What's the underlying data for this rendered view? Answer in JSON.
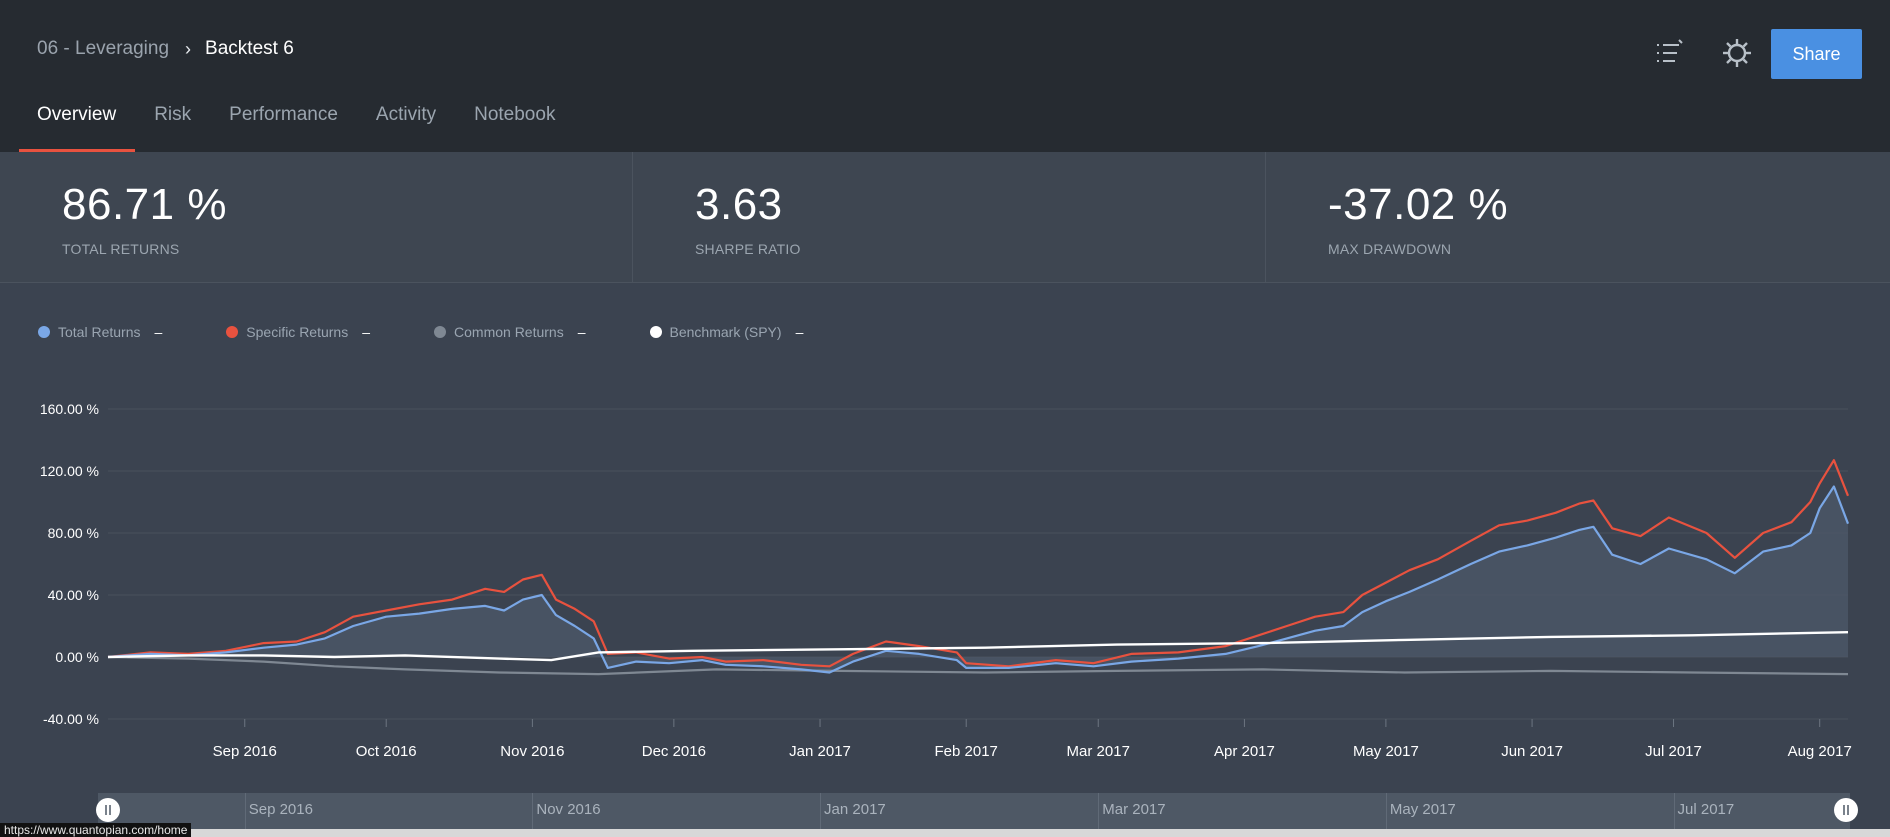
{
  "breadcrumb": {
    "parent": "06 - Leveraging",
    "separator": "›",
    "current": "Backtest 6"
  },
  "tabs": [
    {
      "label": "Overview",
      "active": true
    },
    {
      "label": "Risk",
      "active": false
    },
    {
      "label": "Performance",
      "active": false
    },
    {
      "label": "Activity",
      "active": false
    },
    {
      "label": "Notebook",
      "active": false
    }
  ],
  "header_actions": {
    "list_icon": "list-icon",
    "settings_icon": "gear-icon",
    "share_label": "Share"
  },
  "stats": {
    "total_returns": {
      "value": "86.71 %",
      "label": "TOTAL RETURNS"
    },
    "sharpe_ratio": {
      "value": "3.63",
      "label": "SHARPE RATIO"
    },
    "max_drawdown": {
      "value": "-37.02 %",
      "label": "MAX DRAWDOWN"
    }
  },
  "legend": [
    {
      "name": "Total Returns",
      "value": "–",
      "color": "#7aa7e6"
    },
    {
      "name": "Specific Returns",
      "value": "–",
      "color": "#e8523f"
    },
    {
      "name": "Common Returns",
      "value": "–",
      "color": "#7f8893"
    },
    {
      "name": "Benchmark (SPY)",
      "value": "–",
      "color": "#ffffff"
    }
  ],
  "chart_data": {
    "type": "line",
    "y_tick_labels": [
      "160.00 %",
      "120.00 %",
      "80.00 %",
      "40.00 %",
      "0.00 %",
      "-40.00 %"
    ],
    "y_ticks": [
      160,
      120,
      80,
      40,
      0,
      -40
    ],
    "ylim": [
      -40,
      160
    ],
    "x_tick_labels": [
      "Sep 2016",
      "Oct 2016",
      "Nov 2016",
      "Dec 2016",
      "Jan 2017",
      "Feb 2017",
      "Mar 2017",
      "Apr 2017",
      "May 2017",
      "Jun 2017",
      "Jul 2017",
      "Aug 2017"
    ],
    "x_ticks": [
      "2016-09-01",
      "2016-10-01",
      "2016-11-01",
      "2016-12-01",
      "2017-01-01",
      "2017-02-01",
      "2017-03-01",
      "2017-04-01",
      "2017-05-01",
      "2017-06-01",
      "2017-07-01",
      "2017-08-01"
    ],
    "xlim": [
      "2016-08-03",
      "2017-08-07"
    ],
    "grid": true,
    "series": [
      {
        "name": "Specific Returns",
        "color": "#e8523f",
        "points": [
          [
            "2016-08-03",
            0
          ],
          [
            "2016-08-12",
            3
          ],
          [
            "2016-08-20",
            2
          ],
          [
            "2016-08-28",
            4
          ],
          [
            "2016-09-05",
            9
          ],
          [
            "2016-09-12",
            10
          ],
          [
            "2016-09-18",
            16
          ],
          [
            "2016-09-24",
            26
          ],
          [
            "2016-10-01",
            30
          ],
          [
            "2016-10-08",
            34
          ],
          [
            "2016-10-15",
            37
          ],
          [
            "2016-10-22",
            44
          ],
          [
            "2016-10-26",
            42
          ],
          [
            "2016-10-30",
            50
          ],
          [
            "2016-11-03",
            53
          ],
          [
            "2016-11-06",
            37
          ],
          [
            "2016-11-10",
            31
          ],
          [
            "2016-11-14",
            23
          ],
          [
            "2016-11-17",
            2
          ],
          [
            "2016-11-23",
            3
          ],
          [
            "2016-11-30",
            -1
          ],
          [
            "2016-12-07",
            0
          ],
          [
            "2016-12-12",
            -3
          ],
          [
            "2016-12-20",
            -2
          ],
          [
            "2016-12-28",
            -5
          ],
          [
            "2017-01-03",
            -6
          ],
          [
            "2017-01-08",
            2
          ],
          [
            "2017-01-15",
            10
          ],
          [
            "2017-01-22",
            7
          ],
          [
            "2017-01-30",
            3
          ],
          [
            "2017-02-01",
            -4
          ],
          [
            "2017-02-10",
            -6
          ],
          [
            "2017-02-20",
            -2
          ],
          [
            "2017-02-28",
            -4
          ],
          [
            "2017-03-08",
            2
          ],
          [
            "2017-03-18",
            3
          ],
          [
            "2017-03-28",
            7
          ],
          [
            "2017-04-04",
            14
          ],
          [
            "2017-04-10",
            20
          ],
          [
            "2017-04-16",
            26
          ],
          [
            "2017-04-22",
            29
          ],
          [
            "2017-04-26",
            40
          ],
          [
            "2017-05-01",
            48
          ],
          [
            "2017-05-06",
            56
          ],
          [
            "2017-05-12",
            63
          ],
          [
            "2017-05-19",
            75
          ],
          [
            "2017-05-25",
            85
          ],
          [
            "2017-05-31",
            88
          ],
          [
            "2017-06-06",
            93
          ],
          [
            "2017-06-11",
            99
          ],
          [
            "2017-06-14",
            101
          ],
          [
            "2017-06-18",
            83
          ],
          [
            "2017-06-24",
            78
          ],
          [
            "2017-06-30",
            90
          ],
          [
            "2017-07-08",
            80
          ],
          [
            "2017-07-14",
            64
          ],
          [
            "2017-07-20",
            80
          ],
          [
            "2017-07-26",
            87
          ],
          [
            "2017-07-30",
            100
          ],
          [
            "2017-08-01",
            112
          ],
          [
            "2017-08-04",
            127
          ],
          [
            "2017-08-07",
            104
          ]
        ]
      },
      {
        "name": "Total Returns",
        "color": "#7aa7e6",
        "points": [
          [
            "2016-08-03",
            0
          ],
          [
            "2016-08-12",
            2
          ],
          [
            "2016-08-20",
            1
          ],
          [
            "2016-08-28",
            3
          ],
          [
            "2016-09-05",
            6
          ],
          [
            "2016-09-12",
            8
          ],
          [
            "2016-09-18",
            12
          ],
          [
            "2016-09-24",
            20
          ],
          [
            "2016-10-01",
            26
          ],
          [
            "2016-10-08",
            28
          ],
          [
            "2016-10-15",
            31
          ],
          [
            "2016-10-22",
            33
          ],
          [
            "2016-10-26",
            30
          ],
          [
            "2016-10-30",
            37
          ],
          [
            "2016-11-03",
            40
          ],
          [
            "2016-11-06",
            27
          ],
          [
            "2016-11-10",
            20
          ],
          [
            "2016-11-14",
            12
          ],
          [
            "2016-11-17",
            -7
          ],
          [
            "2016-11-23",
            -3
          ],
          [
            "2016-11-30",
            -4
          ],
          [
            "2016-12-07",
            -2
          ],
          [
            "2016-12-12",
            -5
          ],
          [
            "2016-12-20",
            -6
          ],
          [
            "2016-12-28",
            -8
          ],
          [
            "2017-01-03",
            -10
          ],
          [
            "2017-01-08",
            -3
          ],
          [
            "2017-01-15",
            4
          ],
          [
            "2017-01-22",
            2
          ],
          [
            "2017-01-30",
            -2
          ],
          [
            "2017-02-01",
            -7
          ],
          [
            "2017-02-10",
            -7
          ],
          [
            "2017-02-20",
            -4
          ],
          [
            "2017-02-28",
            -6
          ],
          [
            "2017-03-08",
            -3
          ],
          [
            "2017-03-18",
            -1
          ],
          [
            "2017-03-28",
            2
          ],
          [
            "2017-04-04",
            7
          ],
          [
            "2017-04-10",
            12
          ],
          [
            "2017-04-16",
            17
          ],
          [
            "2017-04-22",
            20
          ],
          [
            "2017-04-26",
            29
          ],
          [
            "2017-05-01",
            36
          ],
          [
            "2017-05-06",
            42
          ],
          [
            "2017-05-12",
            50
          ],
          [
            "2017-05-19",
            60
          ],
          [
            "2017-05-25",
            68
          ],
          [
            "2017-05-31",
            72
          ],
          [
            "2017-06-06",
            77
          ],
          [
            "2017-06-11",
            82
          ],
          [
            "2017-06-14",
            84
          ],
          [
            "2017-06-18",
            66
          ],
          [
            "2017-06-24",
            60
          ],
          [
            "2017-06-30",
            70
          ],
          [
            "2017-07-08",
            63
          ],
          [
            "2017-07-14",
            54
          ],
          [
            "2017-07-20",
            68
          ],
          [
            "2017-07-26",
            72
          ],
          [
            "2017-07-30",
            80
          ],
          [
            "2017-08-01",
            96
          ],
          [
            "2017-08-04",
            110
          ],
          [
            "2017-08-07",
            86
          ]
        ]
      },
      {
        "name": "Common Returns",
        "color": "#7f8893",
        "points": [
          [
            "2016-08-03",
            0
          ],
          [
            "2016-08-20",
            -1
          ],
          [
            "2016-09-05",
            -3
          ],
          [
            "2016-09-20",
            -6
          ],
          [
            "2016-10-05",
            -8
          ],
          [
            "2016-10-25",
            -10
          ],
          [
            "2016-11-15",
            -11
          ],
          [
            "2016-12-10",
            -8
          ],
          [
            "2017-01-05",
            -9
          ],
          [
            "2017-02-05",
            -10
          ],
          [
            "2017-03-05",
            -9
          ],
          [
            "2017-04-05",
            -8
          ],
          [
            "2017-05-05",
            -10
          ],
          [
            "2017-06-05",
            -9
          ],
          [
            "2017-07-05",
            -10
          ],
          [
            "2017-08-07",
            -11
          ]
        ]
      },
      {
        "name": "Benchmark (SPY)",
        "color": "#ffffff",
        "points": [
          [
            "2016-08-03",
            0
          ],
          [
            "2016-08-20",
            1
          ],
          [
            "2016-09-05",
            1
          ],
          [
            "2016-09-20",
            0
          ],
          [
            "2016-10-05",
            1
          ],
          [
            "2016-10-25",
            -1
          ],
          [
            "2016-11-05",
            -2
          ],
          [
            "2016-11-15",
            3
          ],
          [
            "2016-12-05",
            4
          ],
          [
            "2017-01-05",
            5
          ],
          [
            "2017-02-05",
            6
          ],
          [
            "2017-03-05",
            8
          ],
          [
            "2017-04-05",
            9
          ],
          [
            "2017-05-05",
            11
          ],
          [
            "2017-06-05",
            13
          ],
          [
            "2017-07-05",
            14
          ],
          [
            "2017-08-07",
            16
          ]
        ]
      }
    ]
  },
  "navigator": {
    "labels": [
      "Sep 2016",
      "Nov 2016",
      "Jan 2017",
      "Mar 2017",
      "May 2017",
      "Jul 2017"
    ],
    "dates": [
      "2016-09-01",
      "2016-11-01",
      "2017-01-01",
      "2017-03-01",
      "2017-05-01",
      "2017-07-01"
    ]
  },
  "status_url": "https://www.quantopian.com/home"
}
